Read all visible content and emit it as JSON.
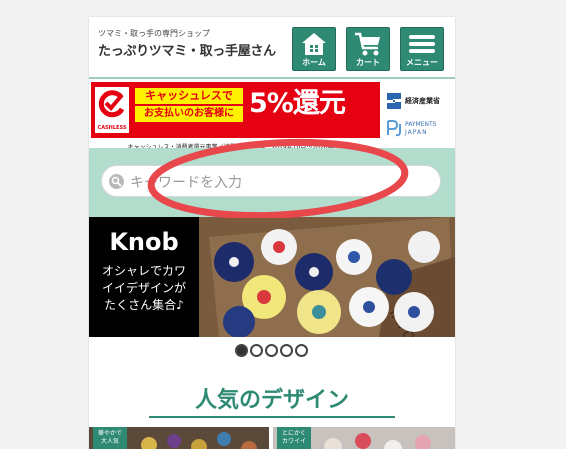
{
  "header": {
    "tagline": "ツマミ・取っ手の専門ショップ",
    "shop_name": "たっぷりツマミ・取っ手屋さん",
    "nav": [
      {
        "label": "ホーム",
        "icon": "home-icon"
      },
      {
        "label": "カート",
        "icon": "cart-icon"
      },
      {
        "label": "メニュー",
        "icon": "menu-icon"
      }
    ]
  },
  "banner": {
    "logo_word": "CASHLESS",
    "line1": "キャッシュレスで",
    "line2": "お支払いのお客様に",
    "big": "5%還元",
    "note": "キャッシュレス・消費者還元事業／消費者還元期間：2019年10月〜2020年6月",
    "meti": "経済産業省",
    "pj_line1": "PAYMENTS",
    "pj_line2": "JAPAN"
  },
  "search": {
    "placeholder": "キーワードを入力",
    "icon": "search-icon"
  },
  "hero": {
    "title": "Knob",
    "copy_line1": "オシャレでカワ",
    "copy_line2": "イイデザインが",
    "copy_line3": "たくさん集合♪"
  },
  "carousel": {
    "count": 5,
    "active": 1
  },
  "popular": {
    "heading": "人気のデザイン"
  },
  "cards": [
    {
      "tag1": "華やかで",
      "tag2": "大人気"
    },
    {
      "tag1": "とにかく",
      "tag2": "カワイイ"
    }
  ],
  "colors": {
    "accent": "#2e8a73",
    "banner_red": "#e50012",
    "banner_yellow": "#fff200",
    "search_bg": "#b2dccc",
    "annotation": "#e8474c"
  }
}
